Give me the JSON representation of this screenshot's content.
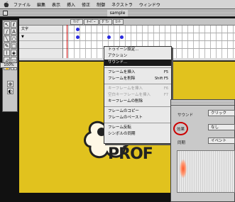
{
  "menubar": {
    "items": [
      "ファイル",
      "編集",
      "表示",
      "挿入",
      "修正",
      "制御",
      "ネクストラ",
      "ウィンドウ"
    ]
  },
  "window": {
    "title": "sample"
  },
  "timeline": {
    "tabs": [
      "ﾏｯﾌﾟ",
      "ｵｰﾊﾞｰ",
      "ﾀﾞｳﾝ",
      "ﾋｯﾄ"
    ],
    "layers": [
      "文字",
      "▼"
    ]
  },
  "zoom": {
    "value": "100%"
  },
  "context_menu": {
    "items": [
      {
        "label": "トゥイーン設定...",
        "shortcut": "",
        "state": "normal"
      },
      {
        "label": "アクション",
        "shortcut": "",
        "state": "normal"
      },
      {
        "label": "サウンド...",
        "shortcut": "",
        "state": "selected"
      },
      {
        "sep": true
      },
      {
        "label": "フレームを挿入",
        "shortcut": "F5",
        "state": "normal"
      },
      {
        "label": "フレームを削除",
        "shortcut": "Shift F5",
        "state": "normal"
      },
      {
        "sep": true
      },
      {
        "label": "キーフレームを挿入",
        "shortcut": "F6",
        "state": "disabled"
      },
      {
        "label": "空白キーフレームを挿入",
        "shortcut": "F7",
        "state": "disabled"
      },
      {
        "label": "キーフレームの削除",
        "shortcut": "",
        "state": "normal"
      },
      {
        "sep": true
      },
      {
        "label": "フレームのコピー",
        "shortcut": "",
        "state": "normal"
      },
      {
        "label": "フレームのペースト",
        "shortcut": "",
        "state": "normal"
      },
      {
        "sep": true
      },
      {
        "label": "フレーム反転",
        "shortcut": "",
        "state": "normal"
      },
      {
        "label": "シンボルの同期",
        "shortcut": "",
        "state": "normal"
      }
    ]
  },
  "properties": {
    "sound_label": "サウンド",
    "sound_value": "クリック",
    "effect_label": "効果",
    "effect_value": "なし",
    "sync_label": "同期",
    "sync_value": "イベント"
  },
  "stage": {
    "logo_text": "PROF"
  },
  "colors": {
    "stage": "#e1c21e",
    "highlight_circle": "#cc0000",
    "keyframe": "#2a2ae0"
  }
}
